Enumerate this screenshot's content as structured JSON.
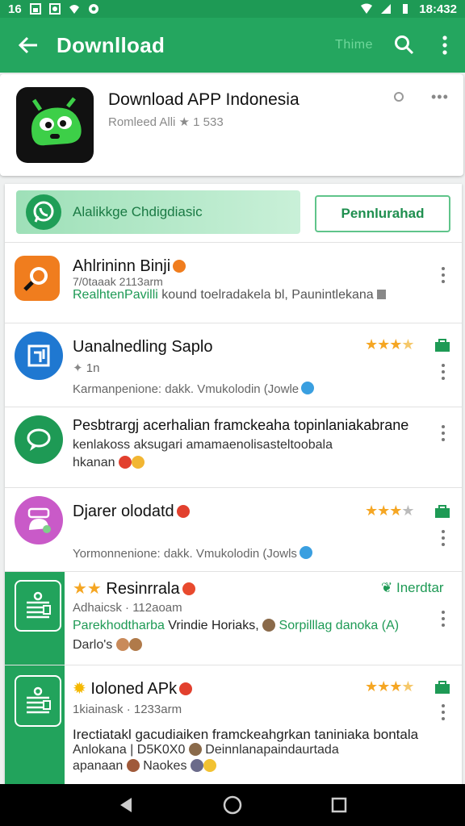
{
  "status_bar": {
    "left_text": "16",
    "time": "18:432"
  },
  "app_bar": {
    "title": "Downlload",
    "theme_label": "Thime"
  },
  "header": {
    "title": "Download APP Indonesia",
    "subtitle": "Romleed Alli ★ 1 533"
  },
  "banner": {
    "text": "Alalikkge Chdigdiasic",
    "install_label": "Pennlurahad"
  },
  "rows": [
    {
      "title": "Ahlrininn Binji",
      "line1": "7/0taaak 2113arm",
      "line2": "RealhtenPavilli",
      "line2b": " kound toelradakela bl, Paunintlekana"
    },
    {
      "title": "Uanalnedling Saplo",
      "line1": "1n",
      "line2": "Karmanpenione: dakk. Vmukolodin (Jowle"
    },
    {
      "title": "Pesbtrargj acerhalian framckeaha topinlaniakabrane",
      "line1": "kenlakoss aksugari amamaenolisasteltoobala",
      "line2": "hkanan"
    },
    {
      "title": "Djarer olodatd",
      "line1": "Yormonnenione: dakk. Vmukolodin (Jowls"
    },
    {
      "title": "Resinrrala",
      "line1": "Adhaicsk · 112aoam",
      "line2": "Parekhodtharba",
      "line2b": " Vrindie Horiaks,",
      "line2c": " Sorpilllag danoka (A)",
      "line3": "Darlo's",
      "right_label": "Inerdtar"
    },
    {
      "title": "Ioloned APk",
      "line1": "1kiainask · 1233arm",
      "line2": "Irectiatakl gacudiaiken framckeahgrkan taniniaka bontala",
      "line3": "Anlokana | D5K0X0",
      "line3b": " Deinnlanapaindaurtada",
      "line4": "apanaan",
      "line4b": " Naokes"
    }
  ],
  "colors": {
    "primary": "#24a65f",
    "primary_dark": "#1e9a55",
    "star": "#f5a623",
    "banner": "#9ee0b8"
  }
}
